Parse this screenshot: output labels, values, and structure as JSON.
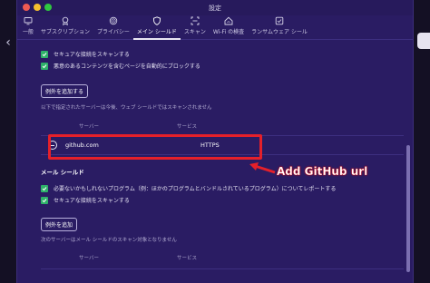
{
  "window": {
    "title": "設定"
  },
  "tabs": [
    {
      "label": "一般",
      "icon": "monitor-icon"
    },
    {
      "label": "サブスクリプション",
      "icon": "award-icon"
    },
    {
      "label": "プライバシー",
      "icon": "fingerprint-icon"
    },
    {
      "label": "メイン シールド",
      "icon": "shield-icon",
      "active": true
    },
    {
      "label": "スキャン",
      "icon": "scan-icon"
    },
    {
      "label": "Wi-Fi の検査",
      "icon": "home-wifi-icon"
    },
    {
      "label": "ランサムウェア シール",
      "icon": "ransom-shield-icon"
    }
  ],
  "web_shield": {
    "checks": [
      "セキュアな接続をスキャンする",
      "悪意のあるコンテンツを含むページを自動的にブロックする"
    ],
    "add_exception_label": "例外を追加する",
    "note": "以下で指定されたサーバーは今後、ウェブ シールドではスキャンされません",
    "col_server": "サーバー",
    "col_service": "サービス",
    "rows": [
      {
        "server": "github.com",
        "service": "HTTPS"
      }
    ]
  },
  "mail_shield": {
    "title": "メール シールド",
    "checks": [
      "必要ないかもしれないプログラム（例：ほかのプログラムとバンドルされているプログラム）についてレポートする",
      "セキュアな接続をスキャンする"
    ],
    "add_exception_label": "例外を追加",
    "note": "次のサーバーはメール シールドのスキャン対象となりません",
    "col_server": "サーバー",
    "col_service": "サービス"
  },
  "annotation": {
    "text": "Add GitHub url",
    "color": "#e5202a"
  },
  "colors": {
    "background": "#2a1c63",
    "check": "#2fb26a",
    "highlight": "#e5202a"
  }
}
